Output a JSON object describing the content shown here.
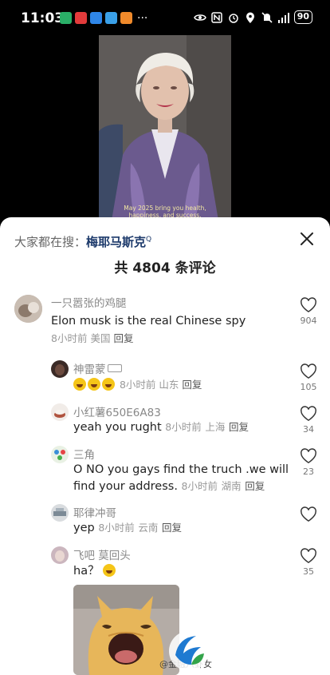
{
  "status": {
    "time": "11:03",
    "more": "...",
    "battery": "90"
  },
  "video": {
    "caption_line1": "May 2025 bring you health,",
    "caption_line2": "happiness, and success."
  },
  "panel": {
    "search_prefix": "大家都在搜：",
    "search_term": "梅耶马斯克",
    "comment_count": "共 4804 条评论"
  },
  "comments": [
    {
      "user": "一只嚣张的鸡腿",
      "text": "Elon musk is the real Chinese spy",
      "time": "8小时前",
      "region": "美国",
      "reply": "回复",
      "likes": "904"
    },
    {
      "user": "神雷蒙",
      "text": "",
      "time": "8小时前",
      "region": "山东",
      "reply": "回复",
      "likes": "105"
    },
    {
      "user": "小红薯650E6A83",
      "text": "yeah you rught",
      "time": "8小时前",
      "region": "上海",
      "reply": "回复",
      "likes": "34"
    },
    {
      "user": "三角",
      "text": "O NO you gays find the truch .we will",
      "text2": "find your address.",
      "time": "8小时前",
      "region": "湖南",
      "reply": "回复",
      "likes": "23"
    },
    {
      "user": "耶律冲哥",
      "text": "yep",
      "time": "8小时前",
      "region": "云南",
      "reply": "回复",
      "likes": ""
    },
    {
      "user": "飞吧 莫回头",
      "text": "ha？",
      "time": "",
      "region": "",
      "reply": "",
      "likes": "35"
    }
  ],
  "watermark": "@金融八卦女"
}
